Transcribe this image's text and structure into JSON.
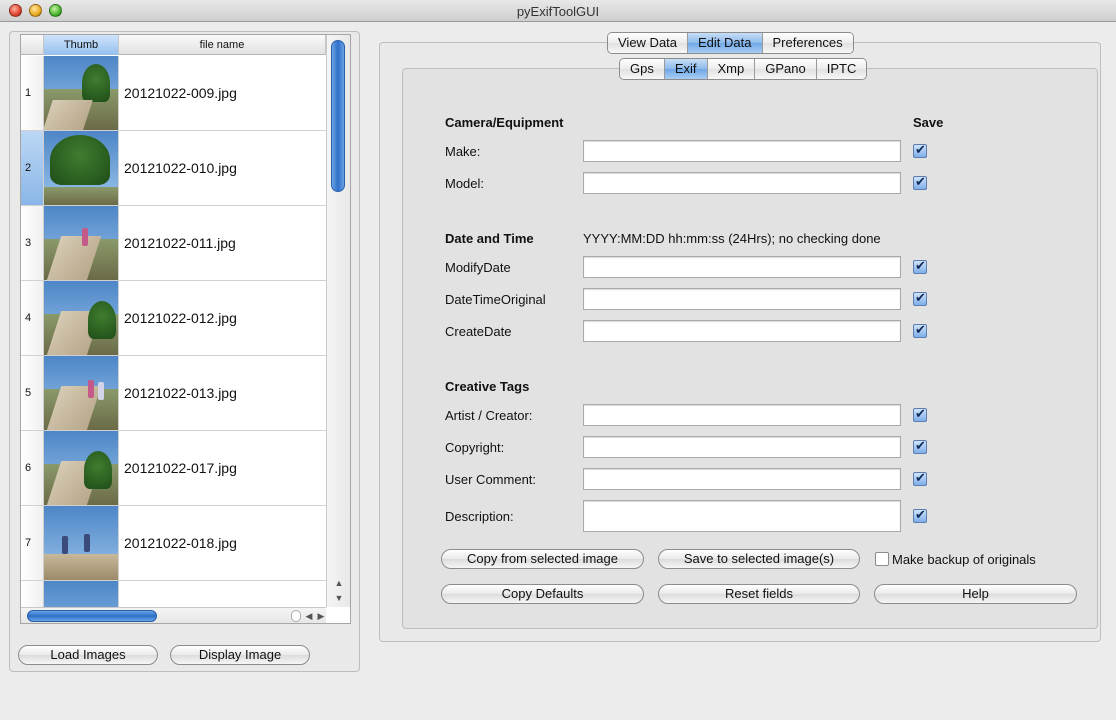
{
  "window": {
    "title": "pyExifToolGUI"
  },
  "file_table": {
    "headers": {
      "thumb": "Thumb",
      "file_name": "file name"
    },
    "rows": [
      {
        "num": "1",
        "name": "20121022-009.jpg"
      },
      {
        "num": "2",
        "name": "20121022-010.jpg"
      },
      {
        "num": "3",
        "name": "20121022-011.jpg"
      },
      {
        "num": "4",
        "name": "20121022-012.jpg"
      },
      {
        "num": "5",
        "name": "20121022-013.jpg"
      },
      {
        "num": "6",
        "name": "20121022-017.jpg"
      },
      {
        "num": "7",
        "name": "20121022-018.jpg"
      },
      {
        "num": "",
        "name": ""
      }
    ],
    "selected_row": "2"
  },
  "left_buttons": {
    "load": "Load Images",
    "display": "Display Image"
  },
  "main_tabs": [
    "View Data",
    "Edit Data",
    "Preferences"
  ],
  "main_tabs_active": "Edit Data",
  "sub_tabs": [
    "Gps",
    "Exif",
    "Xmp",
    "GPano",
    "IPTC"
  ],
  "sub_tabs_active": "Exif",
  "form": {
    "save_header": "Save",
    "camera": {
      "heading": "Camera/Equipment",
      "make_label": "Make:",
      "make_value": "",
      "model_label": "Model:",
      "model_value": ""
    },
    "datetime": {
      "heading": "Date and Time",
      "hint": "YYYY:MM:DD hh:mm:ss (24Hrs); no checking done",
      "modify_label": "ModifyDate",
      "modify_value": "",
      "original_label": "DateTimeOriginal",
      "original_value": "",
      "create_label": "CreateDate",
      "create_value": ""
    },
    "creative": {
      "heading": "Creative Tags",
      "artist_label": "Artist / Creator:",
      "artist_value": "",
      "copyright_label": "Copyright:",
      "copyright_value": "",
      "comment_label": "User Comment:",
      "comment_value": "",
      "description_label": "Description:",
      "description_value": ""
    },
    "save_checks": [
      true,
      true,
      true,
      true,
      true,
      true,
      true,
      true,
      true
    ]
  },
  "actions": {
    "copy_from": "Copy from selected image",
    "save_to": "Save to selected image(s)",
    "backup_label": "Make backup of originals",
    "backup_checked": false,
    "copy_defaults": "Copy Defaults",
    "reset": "Reset fields",
    "help": "Help"
  }
}
